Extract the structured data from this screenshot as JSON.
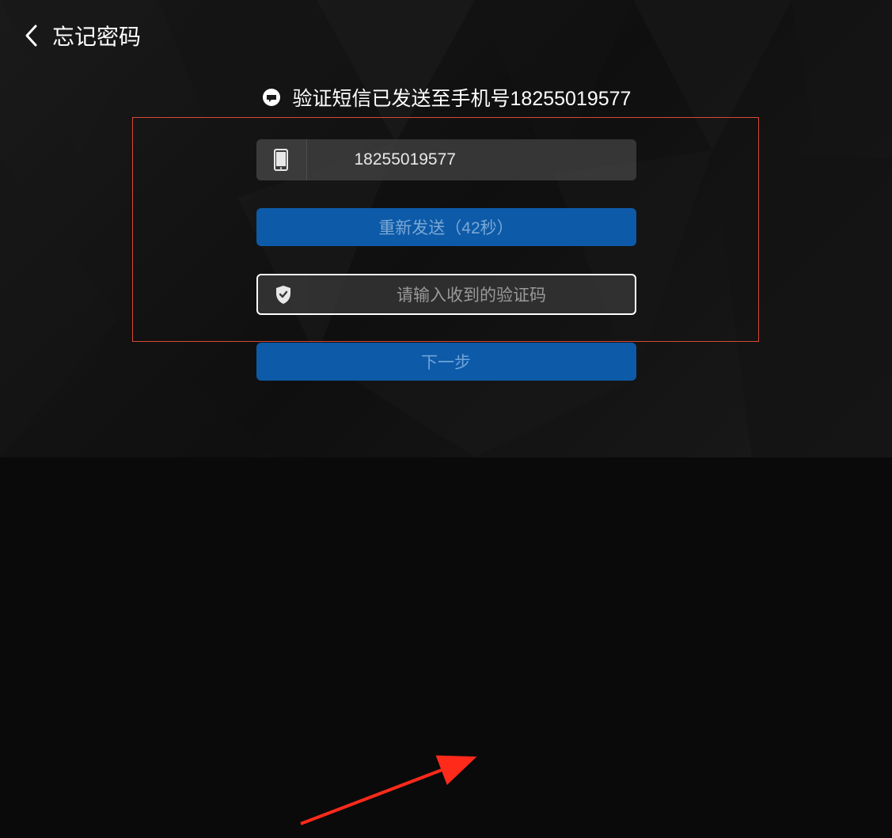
{
  "header": {
    "title": "忘记密码"
  },
  "notice": {
    "text": "验证短信已发送至手机号18255019577"
  },
  "form": {
    "phone_value": "18255019577",
    "resend_label": "重新发送（42秒）",
    "code_placeholder": "请输入收到的验证码",
    "next_label": "下一步"
  }
}
